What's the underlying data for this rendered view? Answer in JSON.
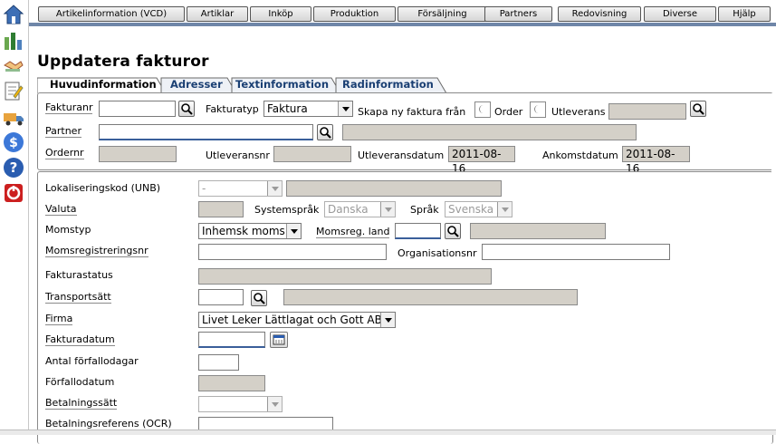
{
  "nav": {
    "items": [
      "Artikelinformation (VCD)",
      "Artiklar",
      "Inköp",
      "Produktion",
      "Försäljning",
      "Partners",
      "Redovisning",
      "Diverse",
      "Hjälp"
    ]
  },
  "sidebar": {
    "icons": [
      "home-icon",
      "chart-icon",
      "handshake-icon",
      "notepad-icon",
      "truck-icon",
      "dollar-icon",
      "help-icon",
      "exit-icon"
    ]
  },
  "page": {
    "title": "Uppdatera fakturor"
  },
  "tabs": [
    "Huvudinformation",
    "Adresser",
    "Textinformation",
    "Radinformation"
  ],
  "header_form": {
    "fakturanr_label": "Fakturanr",
    "fakturanr_value": "",
    "fakturatyp_label": "Fakturatyp",
    "fakturatyp_value": "Faktura",
    "skapa_label": "Skapa ny faktura från",
    "order_label": "Order",
    "utleverans_label": "Utleverans",
    "partner_label": "Partner",
    "partner_value": "",
    "ordernr_label": "Ordernr",
    "utleveransnr_label": "Utleveransnr",
    "utleveransdatum_label": "Utleveransdatum",
    "utleveransdatum_value": "2011-08-16",
    "ankomstdatum_label": "Ankomstdatum",
    "ankomstdatum_value": "2011-08-16"
  },
  "main_form": {
    "lokaliseringskod_label": "Lokaliseringskod (UNB)",
    "lokaliseringskod_value": "-",
    "valuta_label": "Valuta",
    "systemsprak_label": "Systemspråk",
    "systemsprak_value": "Danska",
    "sprak_label": "Språk",
    "sprak_value": "Svenska",
    "momstyp_label": "Momstyp",
    "momstyp_value": "Inhemsk moms",
    "momsreg_land_label": "Momsreg. land",
    "momsregnr_label": "Momsregistreringsnr",
    "organisationsnr_label": "Organisationsnr",
    "fakturastatus_label": "Fakturastatus",
    "transportsatt_label": "Transportsätt",
    "firma_label": "Firma",
    "firma_value": "Livet Leker Lättlagat och Gott AB",
    "fakturadatum_label": "Fakturadatum",
    "antal_forfallodagar_label": "Antal förfallodagar",
    "forfallodatum_label": "Förfallodatum",
    "betalningssatt_label": "Betalningssätt",
    "betalningsreferens_label": "Betalningsreferens (OCR)"
  },
  "colors": {
    "nav_bar": "#6f86a8",
    "readonly_field": "#d4d0c8",
    "tab_link": "#1a3f73"
  }
}
